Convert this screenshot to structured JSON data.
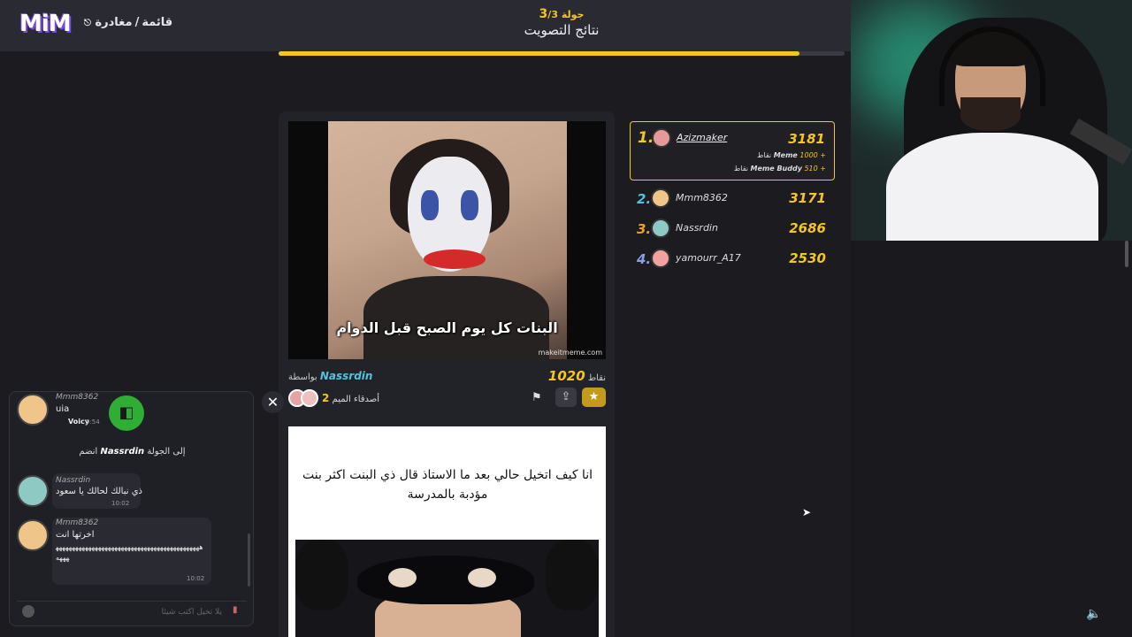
{
  "app": {
    "logo": "MiM",
    "menu_list": "قائمة",
    "menu_leave": "مغادرة"
  },
  "round": {
    "label_prefix": "جولة",
    "current": "3",
    "total": "/3",
    "title": "نتائج التصويت",
    "progress": 0.92
  },
  "meme1": {
    "caption": "البنات كل يوم الصبح قبل الدوام",
    "watermark": "makeitmeme.com",
    "points_value": "1020",
    "points_label": "نقاط",
    "by_label": "بواسطة",
    "author": "Nassrdin",
    "buddy_count": "2",
    "buddy_label": "أصدقاء الميم"
  },
  "meme2": {
    "text": "انا كيف اتخيل حالي بعد ما الاستاذ قال  ذي البنت اكثر بنت مؤدبة بالمدرسة"
  },
  "leaderboard": {
    "first": {
      "rank": "1.",
      "name": "Azizmaker",
      "score": "3181",
      "bonus1_value": "+ 1000",
      "bonus1_label": "Meme",
      "bonus1_unit": "نقاط",
      "bonus2_value": "+ 510",
      "bonus2_label": "Meme Buddy",
      "bonus2_unit": "نقاط"
    },
    "rows": [
      {
        "rank": "2.",
        "name": "Mmm8362",
        "score": "3171"
      },
      {
        "rank": "3.",
        "name": "Nassrdin",
        "score": "2686"
      },
      {
        "rank": "4.",
        "name": "yamourr_A17",
        "score": "2530"
      }
    ]
  },
  "chat": {
    "msg0_name": "Mmm8362",
    "msg0_text": "uia",
    "msg0_sub": "Voicy",
    "msg0_time": "9:54",
    "join_prefix": "إلى الجولة",
    "join_name": "Nassrdin",
    "join_suffix": "انضم",
    "msg1_name": "Nassrdin",
    "msg1_text": "ذي نبالك لحالك يا سعود",
    "msg1_time": "10:02",
    "msg2_name": "Mmm8362",
    "msg2_text": "اخرتها انت",
    "msg2_body": "ههههههههههههههههههههههههههههههههههههههههههههههههه",
    "msg2_time": "10:02",
    "input_placeholder": "يلا تخيل اكتب شيئا"
  },
  "colors": {
    "accent": "#f3c623",
    "teal": "#4ec4e0",
    "panel": "#222229"
  }
}
